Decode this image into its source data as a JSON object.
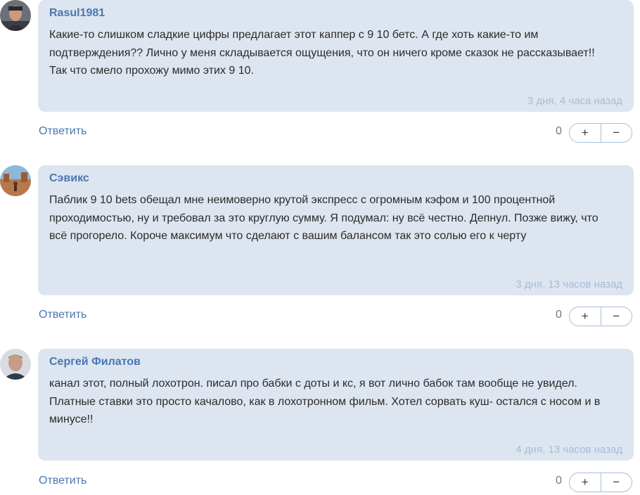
{
  "comments": [
    {
      "author": "Rasul1981",
      "text": "Какие-то слишком сладкие цифры предлагает этот каппер с 9 10 бетс. А где хоть какие-то им подтверждения?? Лично у меня складывается ощущения, что он ничего кроме сказок не рассказывает!! Так что смело прохожу мимо этих 9 10.",
      "time": "3 дня, 4 часа назад",
      "reply_label": "Ответить",
      "score": "0",
      "plus_label": "+",
      "minus_label": "−"
    },
    {
      "author": "Сэвикс",
      "text": "Паблик 9 10 bets обещал мне неимоверно крутой экспресс с огромным кэфом и 100 процентной проходимостью, ну и требовал за это круглую сумму. Я подумал: ну всё честно. Депнул. Позже вижу, что всё прогорело. Короче максимум что сделают с вашим балансом так это солью его к черту",
      "time": "3 дня, 13 часов назад",
      "reply_label": "Ответить",
      "score": "0",
      "plus_label": "+",
      "minus_label": "−"
    },
    {
      "author": "Сергей Филатов",
      "text": "канал этот, полный лохотрон. писал про бабки с доты и кс, я вот лично бабок там вообще не увидел. Платные ставки это просто качалово, как в лохотронном фильм. Хотел сорвать куш- остался с носом и в минусе!!",
      "time": "4 дня, 13 часов назад",
      "reply_label": "Ответить",
      "score": "0",
      "plus_label": "+",
      "minus_label": "−"
    }
  ]
}
